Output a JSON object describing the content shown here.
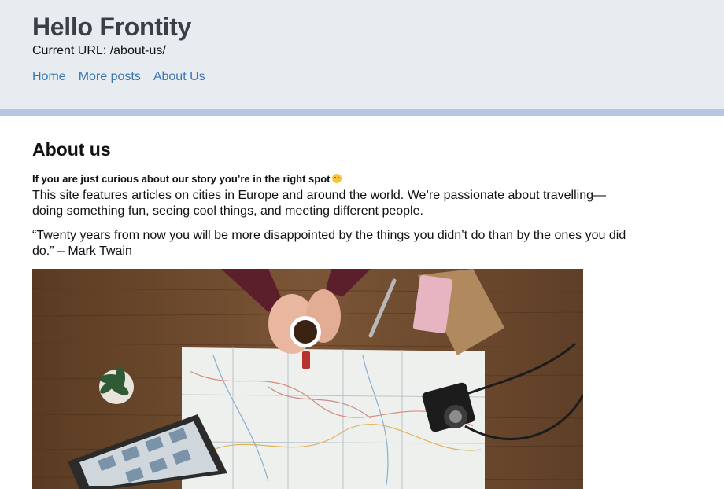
{
  "header": {
    "site_title": "Hello Frontity",
    "current_url": "Current URL: /about-us/",
    "nav": [
      "Home",
      "More posts",
      "About Us"
    ]
  },
  "page": {
    "title": "About us",
    "lead": "If you are just curious about our story you’re in the right spot",
    "paragraph1": "This site features articles on cities in Europe and around the world. We’re passionate about travelling—doing something fun, seeing cool things, and meeting different people.",
    "paragraph2": "“Twenty years from now you will be more disappointed by the things you didn’t do than by the ones you did do.” – Mark Twain"
  },
  "image": {
    "description_icon": "travel-map-photo"
  },
  "colors": {
    "header_bg": "#e6ecef",
    "header_border": "#b6c7e0",
    "link": "#3d76b0",
    "title": "#3a3f45"
  }
}
